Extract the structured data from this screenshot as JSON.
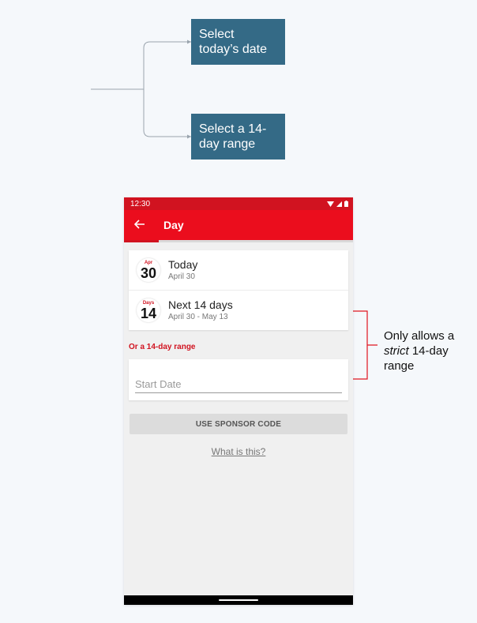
{
  "annotations": {
    "note_today": "Select today’s date",
    "note_range": "Select a 14-day range",
    "side_note_prefix": "Only allows a",
    "side_note_emphasis": "strict",
    "side_note_suffix": "14-day range"
  },
  "phone": {
    "status_bar": {
      "time": "12:30"
    },
    "app_bar": {
      "back_icon": "arrow-back-icon",
      "title": "Day"
    },
    "options": [
      {
        "badge_top": "Apr",
        "badge_num": "30",
        "title": "Today",
        "subtitle": "April 30"
      },
      {
        "badge_top": "Days",
        "badge_num": "14",
        "title": "Next 14 days",
        "subtitle": "April 30 - May 13"
      }
    ],
    "range_label": "Or a 14-day range",
    "start_date_placeholder": "Start Date",
    "sponsor_button": "USE SPONSOR CODE",
    "what_link": "What is this?"
  },
  "colors": {
    "accent_red": "#eb0d1d",
    "status_red": "#d11320",
    "annotation_blue": "#346a86"
  }
}
